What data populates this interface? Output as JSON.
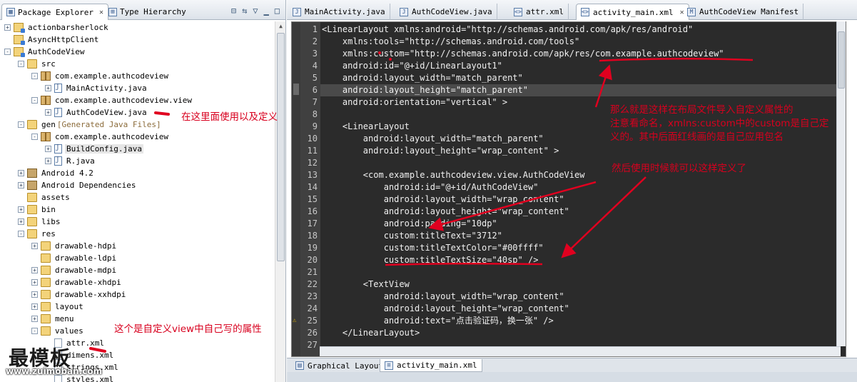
{
  "left_tabs": [
    {
      "label": "Package Explorer",
      "active": true
    },
    {
      "label": "Type Hierarchy",
      "active": false
    }
  ],
  "tree": [
    {
      "depth": 0,
      "twist": "+",
      "icon": "project",
      "label": "actionbarsherlock"
    },
    {
      "depth": 0,
      "twist": "",
      "icon": "project",
      "label": "AsyncHttpClient"
    },
    {
      "depth": 0,
      "twist": "-",
      "icon": "project",
      "label": "AuthCodeView"
    },
    {
      "depth": 1,
      "twist": "-",
      "icon": "folder",
      "label": "src"
    },
    {
      "depth": 2,
      "twist": "-",
      "icon": "pkg",
      "label": "com.example.authcodeview"
    },
    {
      "depth": 3,
      "twist": "+",
      "icon": "jfile",
      "label": "MainActivity.java"
    },
    {
      "depth": 2,
      "twist": "-",
      "icon": "pkg",
      "label": "com.example.authcodeview.view"
    },
    {
      "depth": 3,
      "twist": "+",
      "icon": "jfile",
      "label": "AuthCodeView.java"
    },
    {
      "depth": 1,
      "twist": "-",
      "icon": "folder",
      "label": "gen",
      "decoration": "[Generated Java Files]"
    },
    {
      "depth": 2,
      "twist": "-",
      "icon": "pkg",
      "label": "com.example.authcodeview"
    },
    {
      "depth": 3,
      "twist": "+",
      "icon": "jfile",
      "label": "BuildConfig.java",
      "highlight": true
    },
    {
      "depth": 3,
      "twist": "+",
      "icon": "jfile",
      "label": "R.java"
    },
    {
      "depth": 1,
      "twist": "+",
      "icon": "lib",
      "label": "Android 4.2"
    },
    {
      "depth": 1,
      "twist": "+",
      "icon": "lib",
      "label": "Android Dependencies"
    },
    {
      "depth": 1,
      "twist": "",
      "icon": "folder",
      "label": "assets"
    },
    {
      "depth": 1,
      "twist": "+",
      "icon": "folder",
      "label": "bin"
    },
    {
      "depth": 1,
      "twist": "+",
      "icon": "folder",
      "label": "libs"
    },
    {
      "depth": 1,
      "twist": "-",
      "icon": "folder",
      "label": "res"
    },
    {
      "depth": 2,
      "twist": "+",
      "icon": "folder",
      "label": "drawable-hdpi"
    },
    {
      "depth": 2,
      "twist": "",
      "icon": "folder",
      "label": "drawable-ldpi"
    },
    {
      "depth": 2,
      "twist": "+",
      "icon": "folder",
      "label": "drawable-mdpi"
    },
    {
      "depth": 2,
      "twist": "+",
      "icon": "folder",
      "label": "drawable-xhdpi"
    },
    {
      "depth": 2,
      "twist": "+",
      "icon": "folder",
      "label": "drawable-xxhdpi"
    },
    {
      "depth": 2,
      "twist": "+",
      "icon": "folder",
      "label": "layout"
    },
    {
      "depth": 2,
      "twist": "+",
      "icon": "folder",
      "label": "menu"
    },
    {
      "depth": 2,
      "twist": "-",
      "icon": "folder",
      "label": "values"
    },
    {
      "depth": 3,
      "twist": "",
      "icon": "xfile",
      "label": "attr.xml"
    },
    {
      "depth": 3,
      "twist": "",
      "icon": "xfile",
      "label": "dimens.xml"
    },
    {
      "depth": 3,
      "twist": "",
      "icon": "xfile",
      "label": "strings.xml"
    },
    {
      "depth": 3,
      "twist": "",
      "icon": "xfile",
      "label": "styles.xml"
    }
  ],
  "editor_tabs": [
    {
      "label": "MainActivity.java",
      "icon": "java-file-icon",
      "active": false
    },
    {
      "label": "AuthCodeView.java",
      "icon": "java-file-icon",
      "active": false
    },
    {
      "label": "attr.xml",
      "icon": "xml-file-icon",
      "active": false
    },
    {
      "label": "activity_main.xml",
      "icon": "xml-file-icon",
      "active": true
    },
    {
      "label": "AuthCodeView Manifest",
      "icon": "manifest-icon",
      "active": false
    }
  ],
  "code_lines": [
    "<LinearLayout xmlns:android=\"http://schemas.android.com/apk/res/android\"",
    "    xmlns:tools=\"http://schemas.android.com/tools\"",
    "    xmlns:custom=\"http://schemas.android.com/apk/res/com.example.authcodeview\"",
    "    android:id=\"@+id/LinearLayout1\"",
    "    android:layout_width=\"match_parent\"",
    "    android:layout_height=\"match_parent\"",
    "    android:orientation=\"vertical\" >",
    "",
    "    <LinearLayout",
    "        android:layout_width=\"match_parent\"",
    "        android:layout_height=\"wrap_content\" >",
    "",
    "        <com.example.authcodeview.view.AuthCodeView",
    "            android:id=\"@+id/AuthCodeView\"",
    "            android:layout_width=\"wrap_content\"",
    "            android:layout_height=\"wrap_content\"",
    "            android:padding=\"10dp\"",
    "            custom:titleText=\"3712\"",
    "            custom:titleTextColor=\"#00ffff\"",
    "            custom:titleTextSize=\"40sp\" />",
    "",
    "        <TextView",
    "            android:layout_width=\"wrap_content\"",
    "            android:layout_height=\"wrap_content\"",
    "            android:text=\"点击验证码，换一张\" />",
    "    </LinearLayout>",
    ""
  ],
  "line_numbers": [
    "1",
    "2",
    "3",
    "4",
    "5",
    "6",
    "7",
    "8",
    "9",
    "10",
    "11",
    "12",
    "13",
    "14",
    "15",
    "16",
    "17",
    "18",
    "19",
    "20",
    "21",
    "22",
    "23",
    "24",
    "25",
    "26",
    "27"
  ],
  "current_line": 6,
  "warning_line": 25,
  "bottom_tabs": [
    {
      "label": "Graphical Layout",
      "active": false
    },
    {
      "label": "activity_main.xml",
      "active": true
    }
  ],
  "annotations": {
    "src_note": "在这里面使用以及定义",
    "attr_note": "这个是自定义view中自己写的属性",
    "ns_note_lines": [
      "那么就是这样在布局文件导入自定义属性的",
      "注意看命名，xmlns:custom中的custom是自己定",
      "义的。其中后面红线画的是自己应用包名"
    ],
    "usage_note": "然后使用时候就可以这样定义了"
  },
  "watermark": {
    "brand": "最模板",
    "url": "www.zuimoban.com"
  },
  "colors": {
    "annotation_red": "#d8001e",
    "editor_bg": "#2b2b2b",
    "gutter_bg": "#404040"
  }
}
